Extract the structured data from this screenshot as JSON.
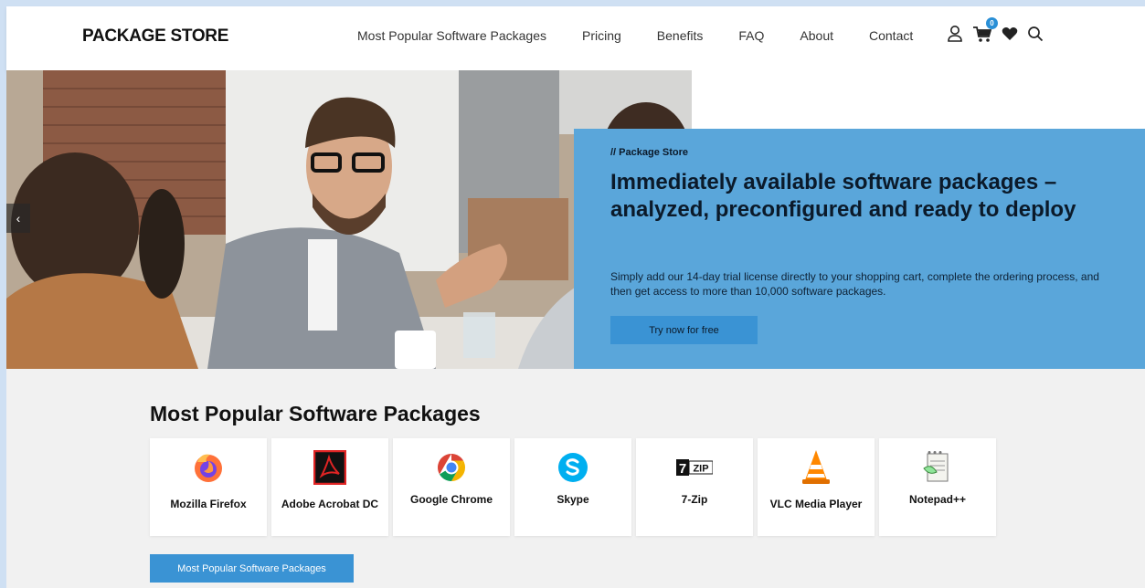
{
  "header": {
    "logo": "PACKAGE STORE",
    "nav": [
      "Most Popular Software Packages",
      "Pricing",
      "Benefits",
      "FAQ",
      "About",
      "Contact"
    ],
    "cart_count": "0",
    "icons": [
      "user-icon",
      "cart-icon",
      "heart-icon",
      "search-icon"
    ]
  },
  "hero": {
    "eyebrow": "// Package Store",
    "headline": "Immediately available software packages – analyzed, preconfigured and ready to deploy",
    "subtext": "Simply add our 14-day trial license directly to your shopping cart, complete the ordering process, and then get access to more than 10,000 software packages.",
    "cta": "Try now for free",
    "prev_arrow": "‹",
    "next_arrow": "›"
  },
  "popular": {
    "title": "Most Popular Software Packages",
    "packages": [
      {
        "name": "Mozilla Firefox",
        "icon": "firefox-icon"
      },
      {
        "name": "Adobe Acrobat DC",
        "icon": "acrobat-icon"
      },
      {
        "name": "Google Chrome",
        "icon": "chrome-icon"
      },
      {
        "name": "Skype",
        "icon": "skype-icon"
      },
      {
        "name": "7-Zip",
        "icon": "7zip-icon"
      },
      {
        "name": "VLC Media Player",
        "icon": "vlc-icon"
      },
      {
        "name": "Notepad++",
        "icon": "notepadpp-icon"
      }
    ],
    "button": "Most Popular Software Packages"
  },
  "colors": {
    "accent": "#3a93d4",
    "hero_panel": "#5aa6da",
    "page_bg": "#cfe0f3"
  }
}
